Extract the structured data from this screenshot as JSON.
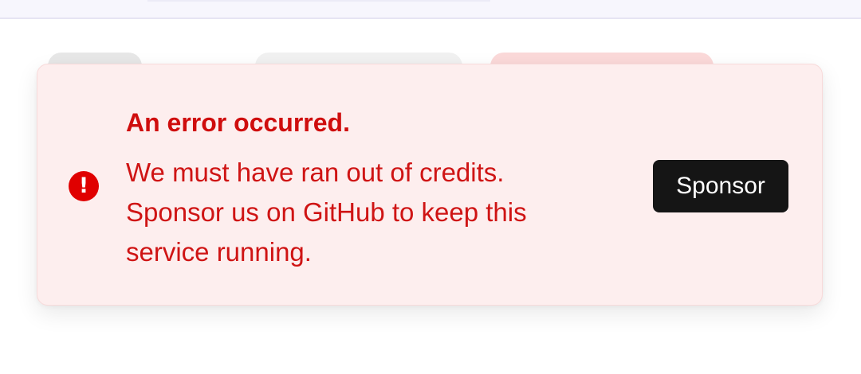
{
  "toast": {
    "icon": "exclamation-circle-icon",
    "icon_glyph": "!",
    "title": "An error occurred.",
    "message": "We must have ran out of credits. Sponsor us on GitHub to keep this service running.",
    "action_label": "Sponsor"
  },
  "colors": {
    "toast_background": "#fdeeee",
    "error_red": "#cf0d0d",
    "icon_red": "#e00000",
    "button_background": "#151515",
    "button_text": "#ffffff"
  }
}
